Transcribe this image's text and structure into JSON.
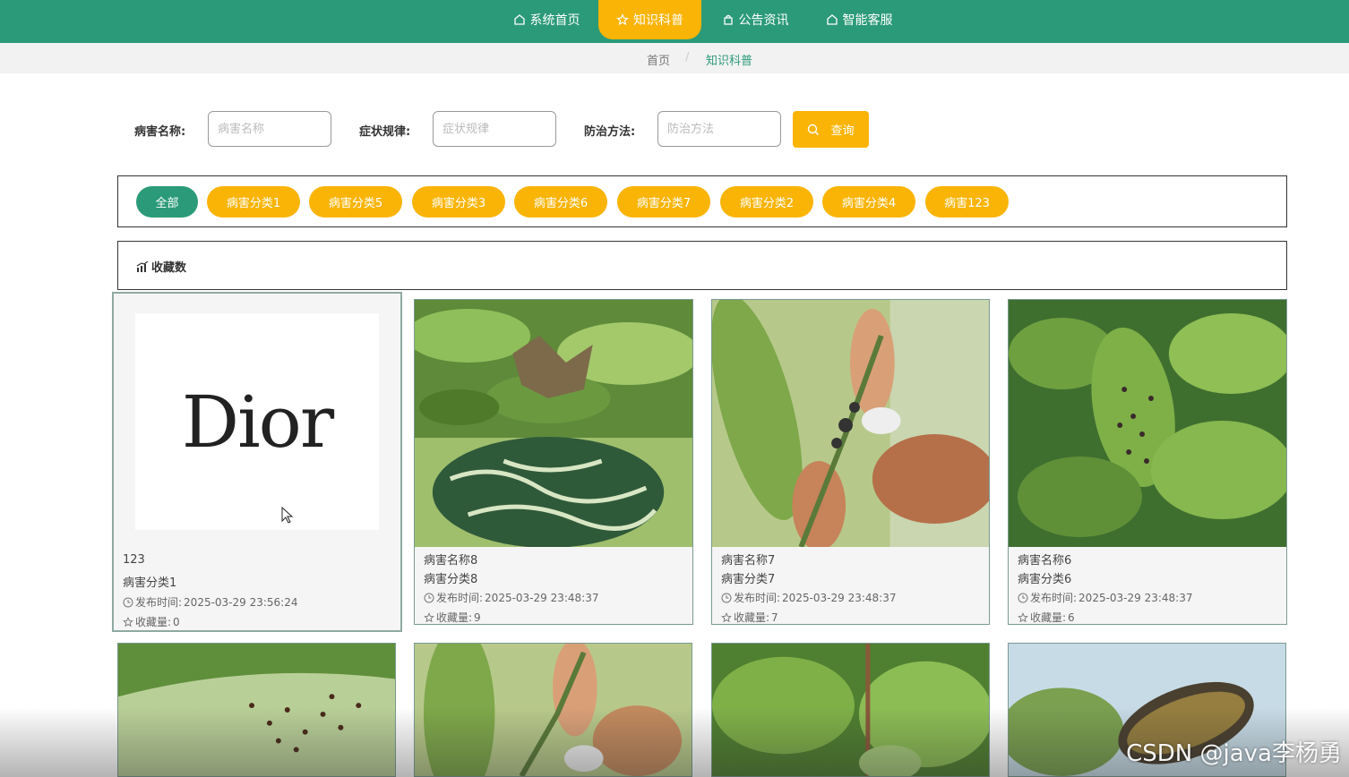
{
  "nav": {
    "items": [
      {
        "label": "系统首页",
        "icon": "home-icon"
      },
      {
        "label": "知识科普",
        "icon": "star-icon",
        "active": true
      },
      {
        "label": "公告资讯",
        "icon": "bag-icon"
      },
      {
        "label": "智能客服",
        "icon": "home-icon"
      }
    ]
  },
  "breadcrumb": {
    "home": "首页",
    "current": "知识科普"
  },
  "search": {
    "name_label": "病害名称:",
    "name_placeholder": "病害名称",
    "symptom_label": "症状规律:",
    "symptom_placeholder": "症状规律",
    "method_label": "防治方法:",
    "method_placeholder": "防治方法",
    "query_label": "查询"
  },
  "categories": [
    "全部",
    "病害分类1",
    "病害分类5",
    "病害分类3",
    "病害分类6",
    "病害分类7",
    "病害分类2",
    "病害分类4",
    "病害123"
  ],
  "sort": {
    "label": "收藏数"
  },
  "cards": [
    {
      "name": "123",
      "category": "病害分类1",
      "time_label": "发布时间:",
      "time": "2025-03-29 23:56:24",
      "fav_label": "收藏量:",
      "fav": "0",
      "image_text": "Dior"
    },
    {
      "name": "病害名称8",
      "category": "病害分类8",
      "time_label": "发布时间:",
      "time": "2025-03-29 23:48:37",
      "fav_label": "收藏量:",
      "fav": "9"
    },
    {
      "name": "病害名称7",
      "category": "病害分类7",
      "time_label": "发布时间:",
      "time": "2025-03-29 23:48:37",
      "fav_label": "收藏量:",
      "fav": "7"
    },
    {
      "name": "病害名称6",
      "category": "病害分类6",
      "time_label": "发布时间:",
      "time": "2025-03-29 23:48:37",
      "fav_label": "收藏量:",
      "fav": "6"
    }
  ],
  "watermark": "CSDN @java李杨勇",
  "colors": {
    "primary": "#2b9a78",
    "accent": "#f9b406"
  }
}
